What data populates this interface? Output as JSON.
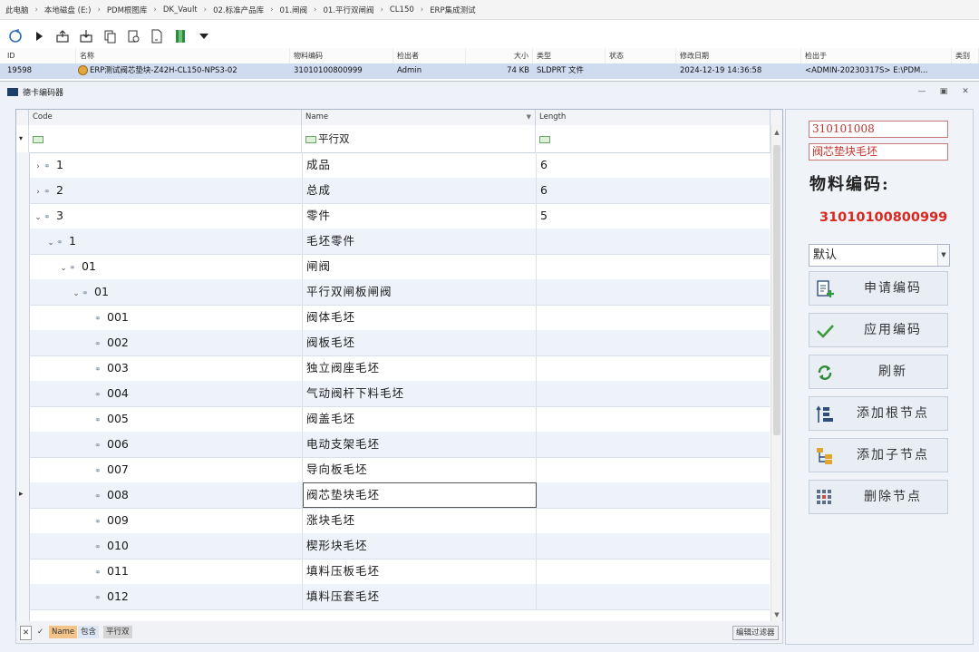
{
  "breadcrumb": [
    "此电脑",
    "本地磁盘 (E:)",
    "PDM根图库",
    "DK_Vault",
    "02.标准产品库",
    "01.闸阀",
    "01.平行双闸阀",
    "CL150",
    "ERP集成测试"
  ],
  "toolbar_icons": [
    "refresh-icon",
    "play-icon",
    "checkout-icon",
    "checkin-icon",
    "copy-icon",
    "properties-icon",
    "document-icon",
    "bookmark-icon",
    "dropdown-arrow-icon"
  ],
  "file_list": {
    "headers": [
      "ID",
      "名称",
      "物料编码",
      "检出者",
      "大小",
      "类型",
      "状态",
      "修改日期",
      "检出于",
      "类别"
    ],
    "row": {
      "id": "19598",
      "name": "ERP测试阀芯垫块-Z42H-CL150-NPS3-02",
      "material_code": "31010100800999",
      "checked_out_by": "Admin",
      "size": "74 KB",
      "type": "SLDPRT 文件",
      "status": "",
      "modified": "2024-12-19 14:36:58",
      "checked_out_at": "<ADMIN-20230317S>  E:\\PDM...",
      "category": ""
    }
  },
  "window": {
    "title": "德卡编码器"
  },
  "grid": {
    "columns": [
      "Code",
      "Name",
      "Length"
    ],
    "filter": {
      "code": "",
      "name": "平行双",
      "length": ""
    },
    "rows": [
      {
        "level": 0,
        "expander": "›",
        "code": "1",
        "name": "成品",
        "length": "6"
      },
      {
        "level": 0,
        "expander": "›",
        "code": "2",
        "name": "总成",
        "length": "6"
      },
      {
        "level": 0,
        "expander": "⌄",
        "code": "3",
        "name": "零件",
        "length": "5"
      },
      {
        "level": 1,
        "expander": "⌄",
        "code": "1",
        "name": "毛坯零件",
        "length": ""
      },
      {
        "level": 2,
        "expander": "⌄",
        "code": "01",
        "name": "闸阀",
        "length": ""
      },
      {
        "level": 3,
        "expander": "⌄",
        "code": "01",
        "name": "平行双闸板闸阀",
        "length": ""
      },
      {
        "level": 4,
        "expander": "",
        "code": "001",
        "name": "阀体毛坯",
        "length": ""
      },
      {
        "level": 4,
        "expander": "",
        "code": "002",
        "name": "阀板毛坯",
        "length": ""
      },
      {
        "level": 4,
        "expander": "",
        "code": "003",
        "name": "独立阀座毛坯",
        "length": ""
      },
      {
        "level": 4,
        "expander": "",
        "code": "004",
        "name": "气动阀杆下料毛坯",
        "length": ""
      },
      {
        "level": 4,
        "expander": "",
        "code": "005",
        "name": "阀盖毛坯",
        "length": ""
      },
      {
        "level": 4,
        "expander": "",
        "code": "006",
        "name": "电动支架毛坯",
        "length": ""
      },
      {
        "level": 4,
        "expander": "",
        "code": "007",
        "name": "导向板毛坯",
        "length": ""
      },
      {
        "level": 4,
        "expander": "",
        "code": "008",
        "name": "阀芯垫块毛坯",
        "length": "",
        "selected": true
      },
      {
        "level": 4,
        "expander": "",
        "code": "009",
        "name": "涨块毛坯",
        "length": ""
      },
      {
        "level": 4,
        "expander": "",
        "code": "010",
        "name": "楔形块毛坯",
        "length": ""
      },
      {
        "level": 4,
        "expander": "",
        "code": "011",
        "name": "填料压板毛坯",
        "length": ""
      },
      {
        "level": 4,
        "expander": "",
        "code": "012",
        "name": "填料压套毛坯",
        "length": ""
      }
    ]
  },
  "filter_bar": {
    "close": "✕",
    "check": "✓",
    "chips": [
      "Name",
      "包含",
      "平行双"
    ],
    "edit_label": "编辑过滤器"
  },
  "right_panel": {
    "code_field": "310101008",
    "name_field": "阀芯垫块毛坯",
    "material_label": "物料编码:",
    "material_code": "31010100800999",
    "combo_value": "默认",
    "buttons": [
      "申请编码",
      "应用编码",
      "刷新",
      "添加根节点",
      "添加子节点",
      "删除节点"
    ]
  },
  "colors": {
    "accent_red": "#d9281e",
    "selected_row": "#cfdcf0",
    "header_bg": "#f2f4f8"
  }
}
